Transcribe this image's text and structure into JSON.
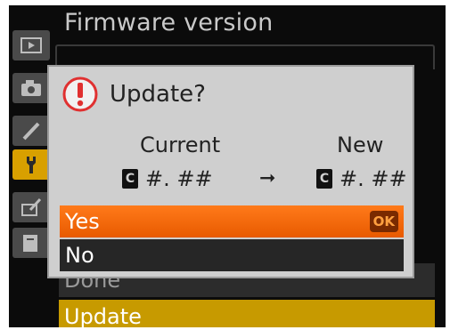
{
  "header": {
    "title": "Firmware version"
  },
  "sidebar": {
    "tabs": [
      {
        "icon": "playback-icon"
      },
      {
        "icon": "camera-icon"
      },
      {
        "icon": "pencil-icon"
      },
      {
        "icon": "wrench-icon",
        "active": true
      },
      {
        "icon": "retouch-icon"
      },
      {
        "icon": "recent-settings-icon"
      }
    ]
  },
  "menu": {
    "items": [
      "Done",
      "Update"
    ]
  },
  "dialog": {
    "title": "Update?",
    "current_label": "Current",
    "new_label": "New",
    "current_prefix": "C",
    "current_version": "#. ##",
    "new_prefix": "C",
    "new_version": "#. ##",
    "arrow": "➞",
    "options": {
      "yes": "Yes",
      "no": "No"
    },
    "ok_badge": "OK"
  },
  "colors": {
    "accent_orange": "#e85a00",
    "selected_gold": "#c79a00",
    "dialog_bg": "#cfcfcf",
    "warning_red": "#e03030"
  }
}
